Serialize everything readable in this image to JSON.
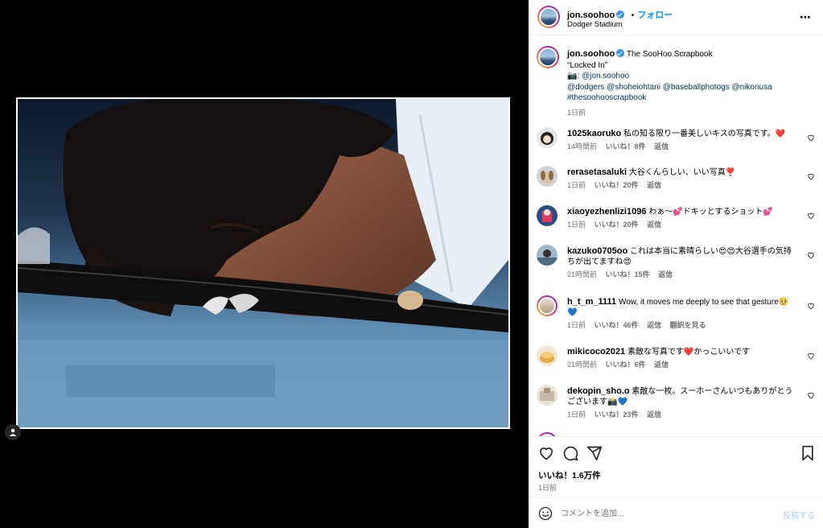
{
  "post": {
    "author": "jon.soohoo",
    "follow_label": "フォロー",
    "separator": "•",
    "location": "Dodger Stadium",
    "more_icon": "more-horizontal-icon"
  },
  "caption": {
    "username": "jon.soohoo",
    "title": "The SooHoo Scrapbook",
    "quote": "“Locked In”",
    "camera_prefix": "📷:",
    "camera_handle": "@jon.soohoo",
    "tags_line1": "@dodgers @shoheiohtani @baseballphotogs @nikonusa",
    "tags_line2": "#thesoohooscrapbook",
    "time": "1日前"
  },
  "comments": [
    {
      "user": "1025kaoruko",
      "text": "私の知る限り一番美しいキスの写真です。❤️",
      "time": "14時間前",
      "likes": "いいね！8件",
      "reply": "返信"
    },
    {
      "user": "rerasetasaluki",
      "text": "大谷くんらしい、いい写真❣️",
      "time": "1日前",
      "likes": "いいね！20件",
      "reply": "返信"
    },
    {
      "user": "xiaoyezhenlizi1096",
      "text": "わぁ〜💕ドキッとするショット💕",
      "time": "1日前",
      "likes": "いいね！20件",
      "reply": "返信"
    },
    {
      "user": "kazuko0705oo",
      "text": "これは本当に素晴らしい😍😍大谷選手の気持ちが出てますね😍",
      "time": "21時間前",
      "likes": "いいね！15件",
      "reply": "返信"
    },
    {
      "user": "h_t_m_1111",
      "text": "Wow, it moves me deeply to see that gesture🥹💙",
      "time": "1日前",
      "likes": "いいね！46件",
      "reply": "返信",
      "translate": "翻訳を見る"
    },
    {
      "user": "mikicoco2021",
      "text": "素敵な写真です❤️かっこいいです",
      "time": "21時間前",
      "likes": "いいね！6件",
      "reply": "返信"
    },
    {
      "user": "dekopin_sho.o",
      "text": "素敵な一枚。スーホーさんいつもありがとうございます📸💙",
      "time": "1日前",
      "likes": "いいね！23件",
      "reply": "返信"
    }
  ],
  "actions": {
    "like_icon": "heart-icon",
    "comment_icon": "comment-icon",
    "share_icon": "share-icon",
    "save_icon": "bookmark-icon",
    "likes_total": "いいね！1.6万件",
    "date": "1日前"
  },
  "add_comment": {
    "placeholder": "コメントを追加...",
    "post_label": "投稿する"
  },
  "colors": {
    "link": "#00376b",
    "follow": "#0095f6",
    "heart": "#ed4956",
    "muted": "#737373"
  }
}
